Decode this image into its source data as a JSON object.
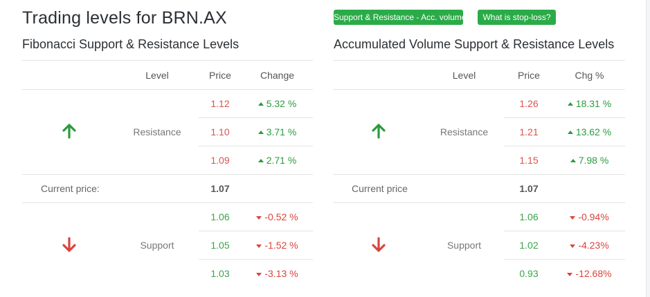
{
  "header": {
    "title": "Trading levels for BRN.AX",
    "btn_support_resistance": "Support & Resistance - Acc. volume",
    "btn_stop_loss": "What is stop-loss?"
  },
  "colors": {
    "button_green": "#2bab48",
    "up_green": "#2a9b3d",
    "down_red": "#d9443b"
  },
  "fib": {
    "title": "Fibonacci Support & Resistance Levels",
    "columns": {
      "level": "Level",
      "price": "Price",
      "change": "Change"
    },
    "resistance_label": "Resistance",
    "support_label": "Support",
    "current_label": "Current price:",
    "current_value": "1.07",
    "resistance": [
      {
        "price": "1.12",
        "change": "5.32 %"
      },
      {
        "price": "1.10",
        "change": "3.71 %"
      },
      {
        "price": "1.09",
        "change": "2.71 %"
      }
    ],
    "support": [
      {
        "price": "1.06",
        "change": "-0.52 %"
      },
      {
        "price": "1.05",
        "change": "-1.52 %"
      },
      {
        "price": "1.03",
        "change": "-3.13 %"
      }
    ]
  },
  "acc": {
    "title": "Accumulated Volume Support & Resistance Levels",
    "columns": {
      "level": "Level",
      "price": "Price",
      "change": "Chg %"
    },
    "resistance_label": "Resistance",
    "support_label": "Support",
    "current_label": "Current price",
    "current_value": "1.07",
    "resistance": [
      {
        "price": "1.26",
        "change": "18.31 %"
      },
      {
        "price": "1.21",
        "change": "13.62 %"
      },
      {
        "price": "1.15",
        "change": "7.98 %"
      }
    ],
    "support": [
      {
        "price": "1.06",
        "change": "-0.94%"
      },
      {
        "price": "1.02",
        "change": "-4.23%"
      },
      {
        "price": "0.93",
        "change": "-12.68%"
      }
    ]
  }
}
